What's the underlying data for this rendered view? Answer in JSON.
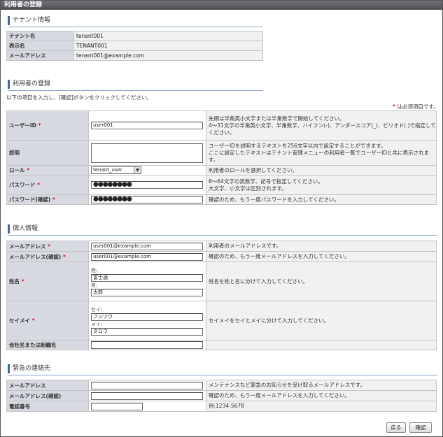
{
  "window": {
    "title": "利用者の登録"
  },
  "tenant_section": {
    "heading": "テナント情報",
    "rows": [
      {
        "label": "テナント名",
        "value": "tenant001"
      },
      {
        "label": "表示名",
        "value": "TENANT001"
      },
      {
        "label": "メールアドレス",
        "value": "tenant001@example.com"
      }
    ]
  },
  "user_section": {
    "heading": "利用者の登録",
    "instruction": "以下の項目を入力し、[確認]ボタンをクリックしてください。",
    "required_note": "は必須項目です。",
    "required_mark": "*",
    "user_id": {
      "label": "ユーザーID",
      "value": "user001",
      "desc": [
        "先頭は半角英小文字または半角数字で開始してください。",
        "4〜31文字の半角英小文字、半角数字、ハイフン(-)、アンダースコア(_)、ピリオド(.)で指定してください。"
      ]
    },
    "description": {
      "label": "説明",
      "value": "",
      "desc": [
        "ユーザーIDを説明するテキストを256文字以内で設定することができます。",
        "ここに設定したテキストはテナント管理メニューの利用者一覧でユーザーIDと共に表示されます。"
      ]
    },
    "role": {
      "label": "ロール",
      "selected": "tenant_user",
      "desc": "利用者のロールを選択してください。"
    },
    "password": {
      "label": "パスワード",
      "masked": "●●●●●●●●",
      "desc": [
        "8〜64文字の英数字、記号で指定してください。",
        "大文字、小文字は区別されます。"
      ]
    },
    "password_confirm": {
      "label": "パスワード(確認)",
      "masked": "●●●●●●●●",
      "desc": "確認のため、もう一度パスワードを入力してください。"
    }
  },
  "personal_section": {
    "heading": "個人情報",
    "email": {
      "label": "メールアドレス",
      "value": "user001@example.com",
      "desc": "利用者のメールアドレスです。"
    },
    "email_confirm": {
      "label": "メールアドレス(確認)",
      "value": "user001@example.com",
      "desc": "確認のため、もう一度メールアドレスを入力してください。"
    },
    "name": {
      "label": "姓名",
      "sei_label": "姓:",
      "sei_value": "富士通",
      "mei_label": "名:",
      "mei_value": "太郎",
      "desc": "姓名を姓と名に分けて入力してください。"
    },
    "kana": {
      "label": "セイメイ",
      "sei_label": "セイ:",
      "sei_value": "フジツウ",
      "mei_label": "メイ:",
      "mei_value": "タロウ",
      "desc": "セイメイをセイとメイに分けて入力してください。"
    },
    "company": {
      "label": "会社名または組織名",
      "value": ""
    }
  },
  "emergency_section": {
    "heading": "緊急の連絡先",
    "email": {
      "label": "メールアドレス",
      "value": "",
      "desc": "メンテナンスなど緊急のお知らせを受け取るメールアドレスです。"
    },
    "email_confirm": {
      "label": "メールアドレス(確認)",
      "value": "",
      "desc": "確認のため、もう一度メールアドレスを入力してください。"
    },
    "phone": {
      "label": "電話番号",
      "value": "",
      "desc": "例:1234-5678"
    }
  },
  "buttons": {
    "back": "戻る",
    "confirm": "確認"
  },
  "colors": {
    "accent": "#3c69a8",
    "required": "#d11a1a",
    "label_bg": "#d7dae0"
  }
}
